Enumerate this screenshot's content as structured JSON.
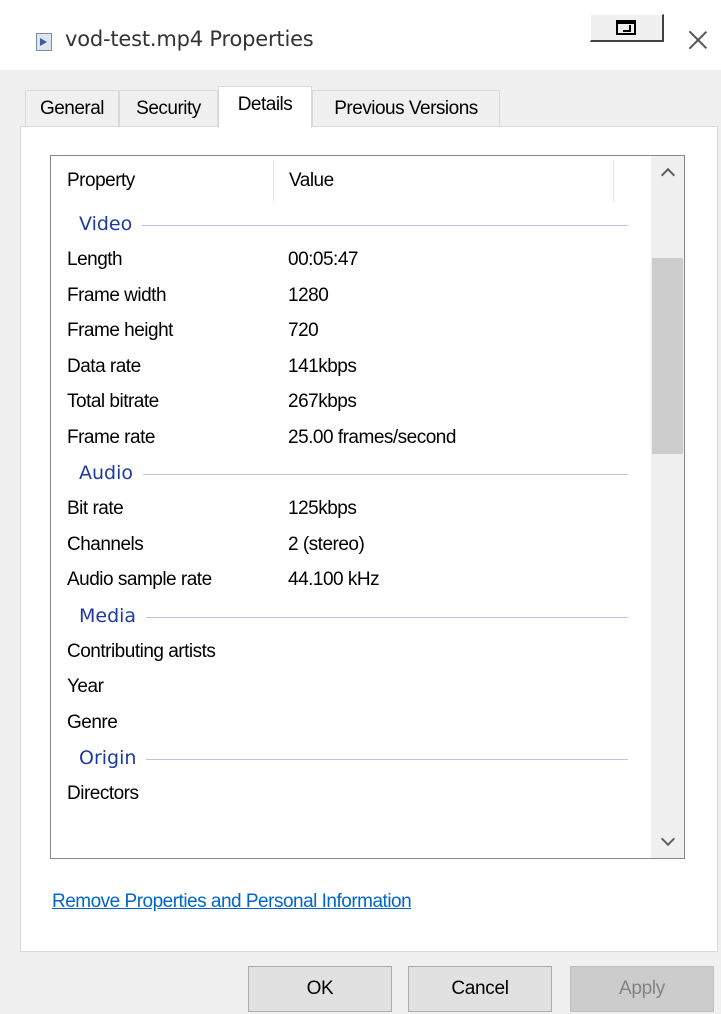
{
  "window": {
    "title": "vod-test.mp4 Properties",
    "icon": "video-file-icon"
  },
  "tabs": [
    {
      "label": "General",
      "active": false
    },
    {
      "label": "Security",
      "active": false
    },
    {
      "label": "Details",
      "active": true
    },
    {
      "label": "Previous Versions",
      "active": false
    }
  ],
  "list": {
    "columns": [
      "Property",
      "Value"
    ],
    "groups": [
      {
        "label": "Video",
        "rows": [
          {
            "name": "Length",
            "value": "00:05:47"
          },
          {
            "name": "Frame width",
            "value": "1280"
          },
          {
            "name": "Frame height",
            "value": "720"
          },
          {
            "name": "Data rate",
            "value": "141kbps"
          },
          {
            "name": "Total bitrate",
            "value": "267kbps"
          },
          {
            "name": "Frame rate",
            "value": "25.00 frames/second"
          }
        ]
      },
      {
        "label": "Audio",
        "rows": [
          {
            "name": "Bit rate",
            "value": "125kbps"
          },
          {
            "name": "Channels",
            "value": "2 (stereo)"
          },
          {
            "name": "Audio sample rate",
            "value": "44.100 kHz"
          }
        ]
      },
      {
        "label": "Media",
        "rows": [
          {
            "name": "Contributing artists",
            "value": ""
          },
          {
            "name": "Year",
            "value": ""
          },
          {
            "name": "Genre",
            "value": ""
          }
        ]
      },
      {
        "label": "Origin",
        "rows": [
          {
            "name": "Directors",
            "value": ""
          }
        ]
      }
    ]
  },
  "link": "Remove Properties and Personal Information",
  "buttons": {
    "ok": "OK",
    "cancel": "Cancel",
    "apply": "Apply"
  },
  "colors": {
    "group_label": "#1e3aa0",
    "link": "#0066cc",
    "window_bg": "#f0f0f0"
  }
}
